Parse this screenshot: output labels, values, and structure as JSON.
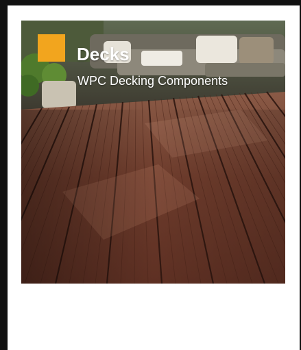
{
  "product_card": {
    "title": "Decks",
    "subtitle": "WPC Decking Components",
    "image_icon": "wpc-deck-boards-image",
    "accent_color": "#f2a51e",
    "deck_color": "#6b3a2b"
  }
}
